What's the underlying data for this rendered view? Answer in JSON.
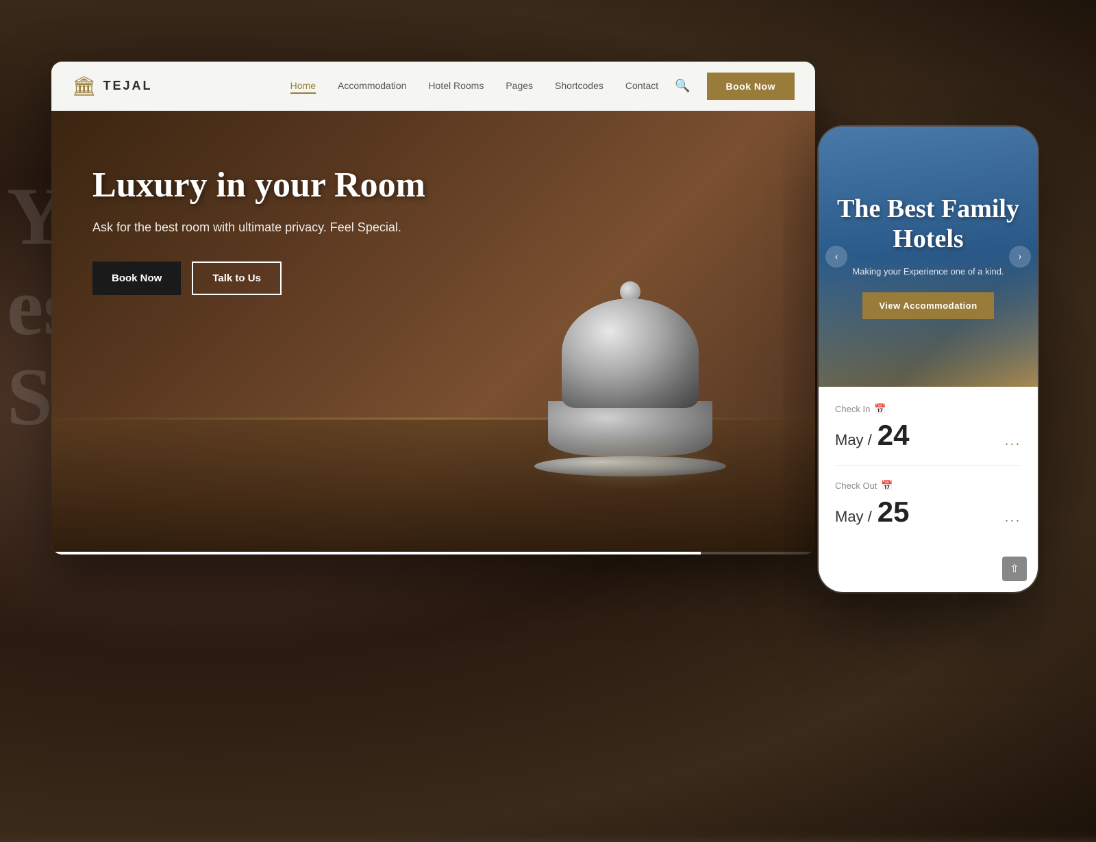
{
  "background": {
    "color": "#4a3a2e"
  },
  "bg_text": {
    "lines": [
      "Y i",
      "est",
      "Sp"
    ]
  },
  "navbar": {
    "logo": {
      "icon": "🏛",
      "text": "TEJAL"
    },
    "links": [
      {
        "label": "Home",
        "active": true
      },
      {
        "label": "Accommodation",
        "active": false
      },
      {
        "label": "Hotel Rooms",
        "active": false
      },
      {
        "label": "Pages",
        "active": false
      },
      {
        "label": "Shortcodes",
        "active": false
      },
      {
        "label": "Contact",
        "active": false
      }
    ],
    "book_now_label": "Book Now"
  },
  "hero": {
    "title": "Luxury in your Room",
    "subtitle": "Ask for the best room with ultimate privacy. Feel Special.",
    "btn_book": "Book Now",
    "btn_talk": "Talk to Us"
  },
  "mobile": {
    "hero": {
      "title": "The Best Family Hotels",
      "subtitle": "Making your Experience one of a kind.",
      "btn_accommodation": "View Accommodation"
    },
    "booking": {
      "checkin_label": "Check In",
      "checkin_month": "May /",
      "checkin_day": "24",
      "checkin_dots": "...",
      "checkout_label": "Check Out",
      "checkout_month": "May /",
      "checkout_day": "25",
      "checkout_dots": "..."
    }
  }
}
